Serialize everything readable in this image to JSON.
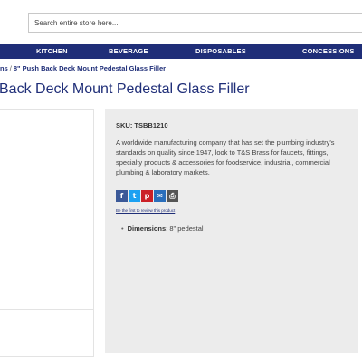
{
  "search": {
    "placeholder": "Search entire store here..."
  },
  "nav": {
    "items": [
      "KITCHEN",
      "BEVERAGE",
      "DISPOSABLES",
      "CONCESSIONS"
    ]
  },
  "breadcrumb": {
    "parent": "ns",
    "separator": "/",
    "current": "8\" Push Back Deck Mount Pedestal Glass Filler"
  },
  "product": {
    "title": "Back Deck Mount Pedestal Glass Filler",
    "sku": "SKU: TSBB1210",
    "description": "A worldwide manufacturing company that has set the plumbing industry's standards on quality since 1947, look to T&S Brass for faucets, fittings, specialty products & accessories for foodservice, industrial, commercial plumbing & laboratory markets.",
    "review_link": "Be the first to review this product",
    "dimensions_label": "Dimensions",
    "dimensions_value": ": 8\" pedestal"
  },
  "share": {
    "icons": [
      {
        "name": "facebook-icon",
        "glyph": "f",
        "color": "#3b5998"
      },
      {
        "name": "twitter-icon",
        "glyph": "t",
        "color": "#1da1f2"
      },
      {
        "name": "pinterest-icon",
        "glyph": "p",
        "color": "#cb2027"
      },
      {
        "name": "email-icon",
        "glyph": "✉",
        "color": "#2a6ebb"
      },
      {
        "name": "print-icon",
        "glyph": "⎙",
        "color": "#555555"
      }
    ]
  },
  "colors": {
    "brand_navy": "#1f2e78",
    "panel_gray": "#ececec"
  }
}
